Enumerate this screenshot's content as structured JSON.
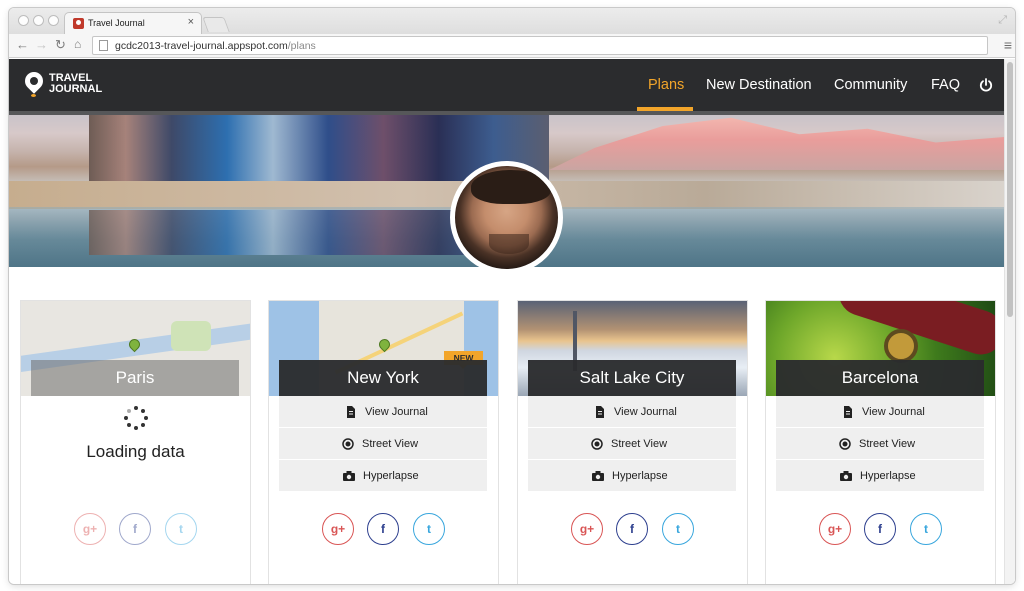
{
  "browser": {
    "tab_title": "Travel Journal",
    "tab_close": "×",
    "url_host": "gcdc2013-travel-journal.appspot.com",
    "url_path": "/plans"
  },
  "header": {
    "logo_line1": "TRAVEL",
    "logo_line2": "JOURNAL",
    "nav": [
      "Plans",
      "New Destination",
      "Community",
      "FAQ"
    ],
    "active_nav": "Plans",
    "accent_color": "#f2a52a",
    "header_color": "#2b2c2e"
  },
  "cards": [
    {
      "city": "Paris",
      "state": "loading",
      "loading_text": "Loading data",
      "social": [
        "g+",
        "f",
        "t"
      ]
    },
    {
      "city": "New York",
      "badge": "NEW",
      "actions": [
        "View Journal",
        "Street View",
        "Hyperlapse"
      ],
      "social": [
        "g+",
        "f",
        "t"
      ]
    },
    {
      "city": "Salt Lake City",
      "actions": [
        "View Journal",
        "Street View",
        "Hyperlapse"
      ],
      "social": [
        "g+",
        "f",
        "t"
      ]
    },
    {
      "city": "Barcelona",
      "actions": [
        "View Journal",
        "Street View",
        "Hyperlapse"
      ],
      "social": [
        "g+",
        "f",
        "t"
      ]
    }
  ],
  "icons": {
    "journal": "document-icon",
    "street_view": "target-icon",
    "hyperlapse": "camera-icon",
    "logout": "power-icon"
  }
}
